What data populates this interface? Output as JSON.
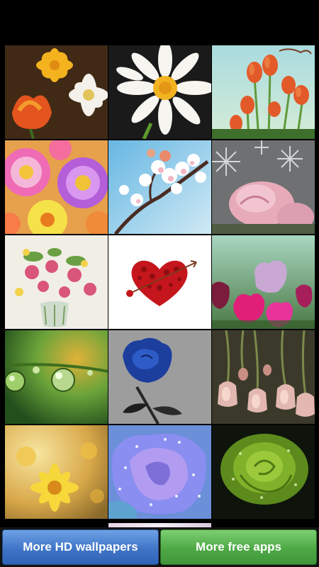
{
  "wallpapers": [
    {
      "icon": "tulips-and-daisies"
    },
    {
      "icon": "white-daisy"
    },
    {
      "icon": "red-tulips-sky"
    },
    {
      "icon": "colorful-gerberas"
    },
    {
      "icon": "cherry-blossom"
    },
    {
      "icon": "frosted-pink-rose"
    },
    {
      "icon": "flower-vase"
    },
    {
      "icon": "rose-petal-heart"
    },
    {
      "icon": "pink-tulips"
    },
    {
      "icon": "dew-drops-on-stem"
    },
    {
      "icon": "blue-rose"
    },
    {
      "icon": "hanging-bell-flowers"
    },
    {
      "icon": "yellow-daisies"
    },
    {
      "icon": "dewy-purple-rose"
    },
    {
      "icon": "green-rose"
    }
  ],
  "bottom_bar": {
    "left_button_label": "More HD wallpapers",
    "right_button_label": "More free apps"
  },
  "colors": {
    "left_button": "#3f75c7",
    "right_button": "#4ea945",
    "background": "#000000"
  }
}
